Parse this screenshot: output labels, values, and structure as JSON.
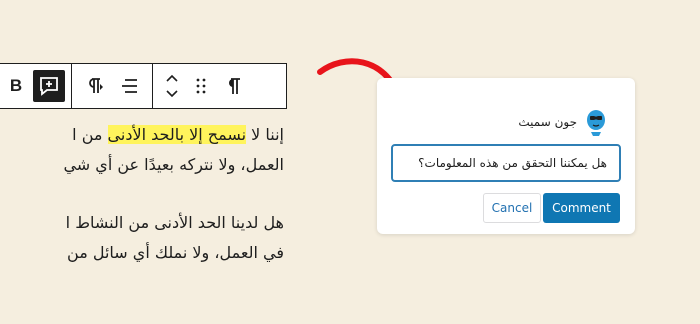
{
  "toolbar": {
    "bold_label": "B",
    "icons": [
      "bold-icon",
      "add-comment-icon",
      "text-direction-icon",
      "align-icon",
      "move-up-down-icon",
      "drag-handle-icon",
      "paragraph-icon"
    ]
  },
  "editor": {
    "p1_line1_pre": "إننا لا ",
    "p1_line1_highlight": "نسمح إلا بالحد الأدنى",
    "p1_line1_post": " من ا",
    "p1_line2": "العمل، ولا نتركه بعيدًا عن أي شي",
    "p2_line1": "هل لدينا الحد الأدنى من النشاط ا",
    "p2_line2": "في العمل، ولا نملك أي سائل من"
  },
  "comment": {
    "author": "جون سميث",
    "input_value": "هل يمكننا التحقق من هذه المعلومات؟",
    "cancel_label": "Cancel",
    "submit_label": "Comment"
  },
  "colors": {
    "background": "#f5eedf",
    "highlight": "#fff45c",
    "arrow": "#e8141b",
    "primary": "#0f77b3",
    "input_border": "#2f7fb5"
  }
}
